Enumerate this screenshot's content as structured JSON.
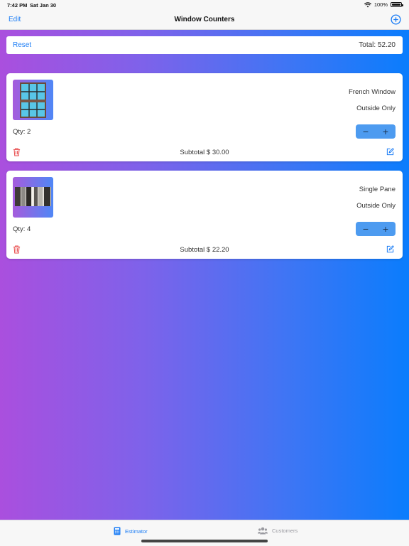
{
  "status_bar": {
    "time": "7:42 PM",
    "date": "Sat Jan 30",
    "battery": "100%",
    "battery_level": 1.0
  },
  "nav": {
    "edit_label": "Edit",
    "title": "Window Counters",
    "add_icon": "plus-circle-icon"
  },
  "summary": {
    "reset_label": "Reset",
    "total_text": "Total: 52.20"
  },
  "items": [
    {
      "type": "French Window",
      "scope": "Outside Only",
      "qty_text": "Qty: 2",
      "subtotal_text": "Subtotal $  30.00",
      "thumb_icon": "window-grid-image"
    },
    {
      "type": "Single Pane",
      "scope": "Outside Only",
      "qty_text": "Qty: 4",
      "subtotal_text": "Subtotal $  22.20",
      "thumb_icon": "window-photo-image"
    }
  ],
  "stepper": {
    "minus": "−",
    "plus": "+"
  },
  "tabs": [
    {
      "label": "Estimator",
      "icon": "calculator-icon",
      "active": true
    },
    {
      "label": "Customers",
      "icon": "people-icon",
      "active": false
    }
  ],
  "colors": {
    "accent": "#1a7cf5",
    "gradient_start": "#aa4fde",
    "gradient_end": "#0a7dfd",
    "delete": "#e8494a"
  }
}
